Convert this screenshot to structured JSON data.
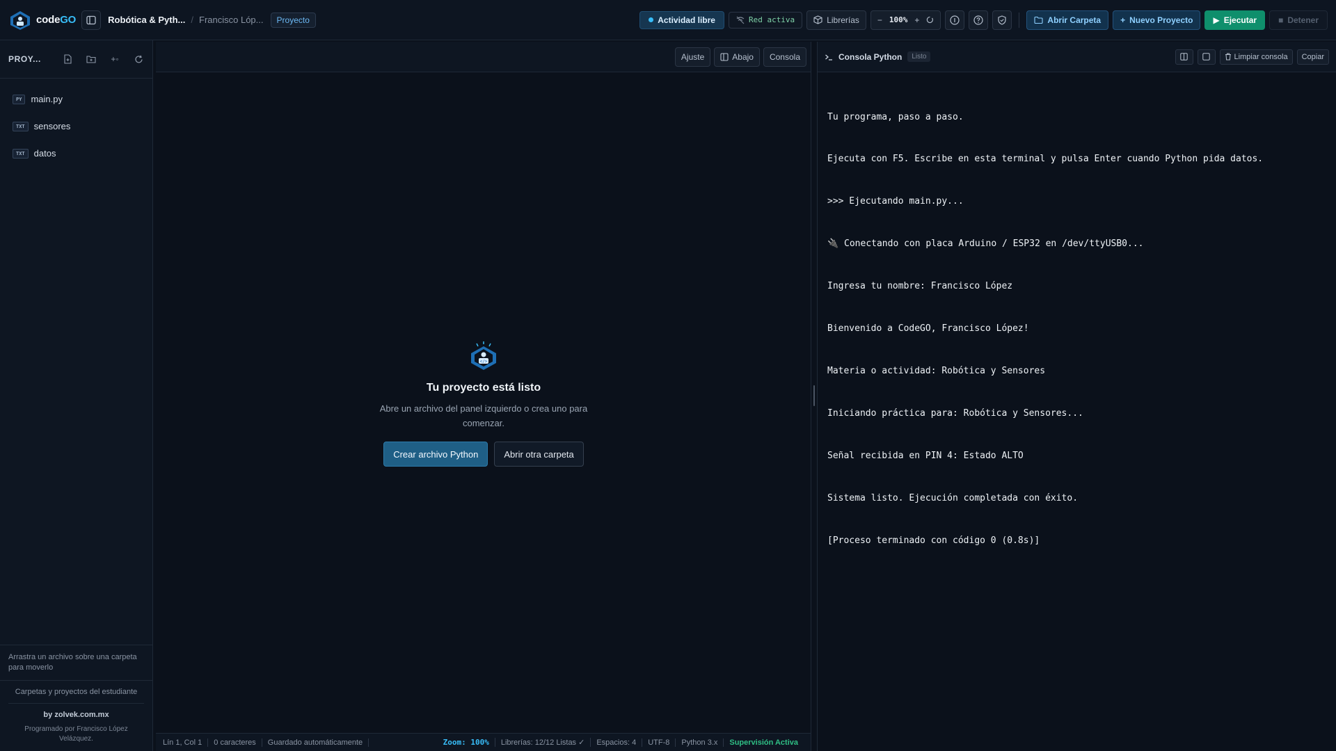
{
  "topbar": {
    "logo_prefix": "code",
    "logo_suffix": "GO",
    "project_title": "Robótica & Pyth...",
    "author_short": "Francisco Lóp...",
    "project_badge": "Proyecto",
    "activity_label": "Actividad libre",
    "network_label": "Red activa",
    "libraries_label": "Librerías",
    "zoom_minus": "−",
    "zoom_value": "100%",
    "zoom_plus": "+",
    "open_folder_label": "Abrir Carpeta",
    "new_project_label": "Nuevo Proyecto",
    "run_label": "Ejecutar",
    "stop_label": "Detener"
  },
  "sidebar": {
    "title": "PROY...",
    "files": [
      {
        "tag": "PY",
        "name": "main.py"
      },
      {
        "tag": "TXT",
        "name": "sensores"
      },
      {
        "tag": "TXT",
        "name": "datos"
      }
    ],
    "drag_hint": "Arrastra un archivo sobre una carpeta para moverlo",
    "caption": "Carpetas y proyectos del estudiante",
    "credit_by": "by zolvek.com.mx",
    "credit_author": "Programado por Francisco López Velázquez."
  },
  "editor": {
    "toolbar": {
      "wrap_label": "Ajuste",
      "down_label": "Abajo",
      "console_label": "Consola"
    },
    "empty_title": "Tu proyecto está listo",
    "empty_desc": "Abre un archivo del panel izquierdo o crea uno para comenzar.",
    "create_python_label": "Crear archivo Python",
    "open_folder_label": "Abrir otra carpeta"
  },
  "statusbar": {
    "cursor": "Lín 1, Col 1",
    "chars": "0 caracteres",
    "autosave": "Guardado automáticamente",
    "zoom": "Zoom: 100%",
    "libraries": "Librerías: 12/12 Listas ✓",
    "spaces": "Espacios: 4",
    "encoding": "UTF-8",
    "python": "Python 3.x",
    "supervision": "Supervisión Activa"
  },
  "console": {
    "title": "Consola Python",
    "status": "Listo",
    "clear_label": "Limpiar consola",
    "copy_label": "Copiar",
    "lines": [
      "Tu programa, paso a paso.",
      "Ejecuta con F5. Escribe en esta terminal y pulsa Enter cuando Python pida datos.",
      ">>> Ejecutando main.py...",
      "🔌 Conectando con placa Arduino / ESP32 en /dev/ttyUSB0...",
      "Ingresa tu nombre: Francisco López",
      "Bienvenido a CodeGO, Francisco López!",
      "Materia o actividad: Robótica y Sensores",
      "Iniciando práctica para: Robótica y Sensores...",
      "Señal recibida en PIN 4: Estado ALTO",
      "Sistema listo. Ejecución completada con éxito.",
      "[Proceso terminado con código 0 (0.8s)]"
    ]
  },
  "icons": {
    "sidebar_toggle": "sidebar-toggle-icon",
    "libraries": "package-icon",
    "info": "info-icon",
    "help": "help-icon",
    "shield": "shield-icon",
    "folder": "folder-icon",
    "plus": "plus-icon",
    "play": "play-icon",
    "stop": "stop-icon"
  },
  "colors": {
    "accent": "#38bdf8",
    "run_green": "#0f8f6c",
    "supervision_green": "#2fbf85",
    "background": "#0b111b"
  }
}
